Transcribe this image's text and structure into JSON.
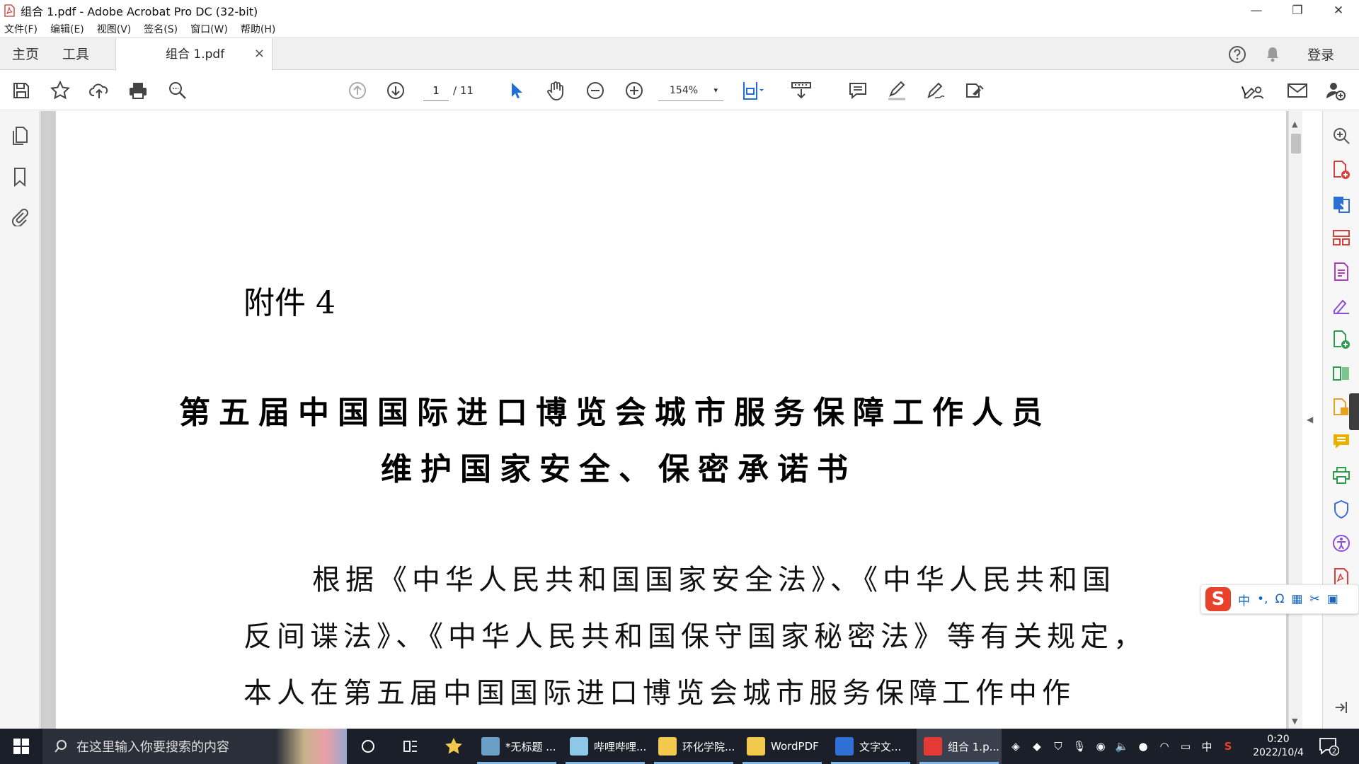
{
  "window": {
    "title": "组合 1.pdf - Adobe Acrobat Pro DC (32-bit)",
    "minimize": "—",
    "restore": "❐",
    "close": "✕"
  },
  "menu": [
    "文件(F)",
    "编辑(E)",
    "视图(V)",
    "签名(S)",
    "窗口(W)",
    "帮助(H)"
  ],
  "tabs": {
    "home": "主页",
    "tools": "工具",
    "document": "组合 1.pdf",
    "close": "×",
    "login": "登录"
  },
  "toolbar": {
    "page_current": "1",
    "page_total": "/ 11",
    "zoom": "154%",
    "zoom_caret": "▾"
  },
  "document": {
    "attachment_label": "附件 4",
    "title_line1": "第五届中国国际进口博览会城市服务保障工作人员",
    "title_line2": "维护国家安全、保密承诺书",
    "body_line1": "根据《中华人民共和国国家安全法》、《中华人民共和国",
    "body_line2": "反间谍法》、《中华人民共和国保守国家秘密法》等有关规定，",
    "body_line3": "本人在第五届中国国际进口博览会城市服务保障工作中作"
  },
  "scrollbar": {
    "up": "▲",
    "down": "▼"
  },
  "collapse": {
    "left": "◀",
    "right": "◀"
  },
  "ime": {
    "logo": "S",
    "items": [
      "中",
      "•,",
      "Ω",
      "▦",
      "✂",
      "▣"
    ]
  },
  "taskbar": {
    "search_placeholder": "在这里输入你要搜索的内容",
    "apps": [
      {
        "label": "*无标题 ...",
        "icon_color": "#6aa0c8"
      },
      {
        "label": "哔哩哔哩...",
        "icon_color": "#8ec8e8"
      },
      {
        "label": "环化学院...",
        "icon_color": "#f2c94c"
      },
      {
        "label": "WordPDF",
        "icon_color": "#f2c94c"
      },
      {
        "label": "文字文...",
        "icon_color": "#2f6fd6"
      },
      {
        "label": "组合 1.p...",
        "icon_color": "#e53935"
      }
    ],
    "tray": [
      "中"
    ],
    "time": "0:20",
    "date": "2022/10/4",
    "notifications": "2"
  },
  "colors": {
    "acrobat_red": "#e53935",
    "toolbar_blue": "#1e6fd9",
    "right_pane_icons": [
      "#d93f3f",
      "#2d6fd3",
      "#d93f3f",
      "#b03fb5",
      "#2e9c4a",
      "#e8a020",
      "#e8b000",
      "#2e9c4a",
      "#3b6bd6",
      "#8a4fd6",
      "#d93f3f"
    ]
  }
}
